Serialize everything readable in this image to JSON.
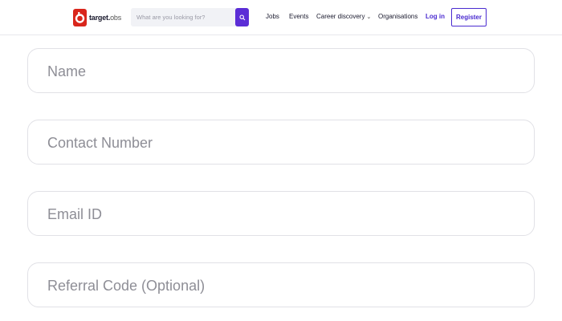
{
  "header": {
    "logo": {
      "brand": "target",
      "suffix": "obs"
    },
    "search": {
      "placeholder": "What are you looking for?"
    },
    "nav": [
      {
        "label": "Jobs"
      },
      {
        "label": "Events"
      },
      {
        "label": "Career discovery"
      },
      {
        "label": "Organisations"
      }
    ],
    "login_label": "Log in",
    "register_label": "Register"
  },
  "form": {
    "fields": [
      {
        "placeholder": "Name",
        "value": ""
      },
      {
        "placeholder": "Contact Number",
        "value": ""
      },
      {
        "placeholder": "Email ID",
        "value": ""
      },
      {
        "placeholder": "Referral Code (Optional)",
        "value": ""
      }
    ]
  },
  "colors": {
    "accent": "#4a2bd0",
    "logo_red": "#d9261c",
    "search_button": "#5b2dd6"
  }
}
